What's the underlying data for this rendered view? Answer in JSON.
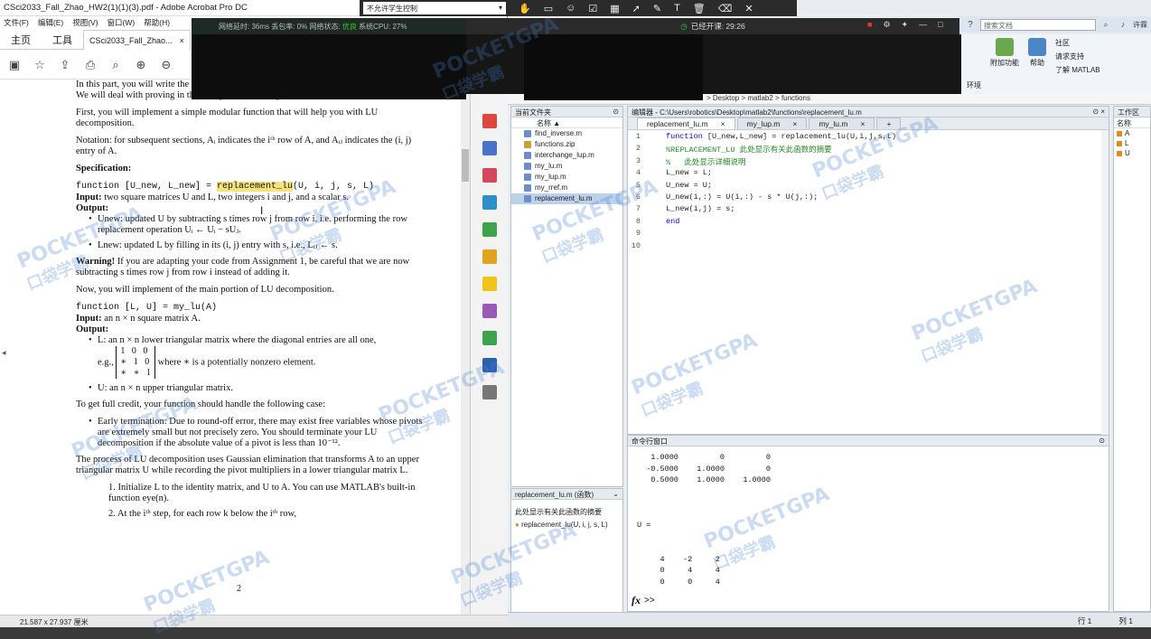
{
  "acrobat": {
    "title": "CSci2033_Fall_Zhao_HW2(1)(1)(3).pdf - Adobe Acrobat Pro DC",
    "menu": [
      "文件(F)",
      "编辑(E)",
      "视图(V)",
      "窗口(W)",
      "帮助(H)"
    ],
    "tabs": {
      "home": "主页",
      "tools": "工具",
      "doc": "CSci2033_Fall_Zhao...",
      "close": "×"
    },
    "status": "21.587 x 27.937 厘米",
    "page_number": "2"
  },
  "pdf": {
    "intro1": "In this part, you will write the function to perform LU decomposition with partial pivoting. We will deal with proving in the next part of the assignment.",
    "intro2": "First, you will implement a simple modular function that will help you with LU decomposition.",
    "notation": "Notation: for subsequent sections, Aᵢ indicates the iᵗʰ row of A, and Aᵢⱼ indicates the (i, j) entry of A.",
    "spec_heading": "Specification:",
    "sig1_pre": "function [U_new, L_new] = ",
    "sig1_hl": "replacement_lu",
    "sig1_post": "(U, i, j, s, L)",
    "input1_label": "Input:",
    "input1": " two square matrices U and L, two integers i and j, and a scalar s.",
    "output_label": "Output:",
    "out1": "Unew: updated U by subtracting s times row j from row i, i.e. performing the row replacement operation Uᵢ ← Uᵢ − sUⱼ.",
    "out2": "Lnew: updated L by filling in its (i, j) entry with s, i.e., Lᵢⱼ ← s.",
    "warning_label": "Warning!",
    "warning": " If you are adapting your code from Assignment 1, be careful that we are now subtracting s times row j from row i instead of adding it.",
    "now": "Now, you will implement of the main portion of LU decomposition.",
    "sig2": "function [L, U] = my_lu(A)",
    "input2_label": "Input:",
    "input2": " an n × n square matrix A.",
    "output2_label": "Output:",
    "outL": "L: an n × n lower triangular matrix where the diagonal entries are all one,",
    "eg": "e.g.,",
    "matrix_rows": [
      "1   0   0",
      "∗   1   0",
      "∗   ∗   1"
    ],
    "eg_after": " where ∗ is a potentially nonzero element.",
    "outU": "U: an n × n upper triangular matrix.",
    "credit": "To get full credit, your function should handle the following case:",
    "early": "Early termination: Due to round-off error, there may exist free variables whose pivots are extremely small but not precisely zero. You should terminate your LU decomposition if the absolute value of a pivot is less than 10⁻¹².",
    "process": "The process of LU decomposition uses Gaussian elimination that transforms A to an upper triangular matrix U while recording the pivot multipliers in a lower triangular matrix L.",
    "step1": "1. Initialize L to the identity matrix, and U to A. You can use MATLAB's built-in function eye(n).",
    "step2": "2. At the iᵗʰ step, for each row k below the iᵗʰ row,"
  },
  "overlay": {
    "netstat": "网络延时: 36ms  丢包率: 0%  网络状态: ",
    "netstat_ok": "优良",
    "cpu": "   系统CPU: 27%",
    "control": "不允许学生控制",
    "timer": "已经开课: 29:26"
  },
  "matlab": {
    "search_placeholder": "搜索文档",
    "user": "许霖",
    "ribbon": {
      "addons": "附加功能",
      "help": "帮助",
      "community": "社区",
      "support": "请求支持",
      "learn": "了解 MATLAB",
      "env": "环境"
    },
    "path": "> Desktop > matlab2 > functions",
    "current_folder": {
      "title": "当前文件夹",
      "col_name": "名称 ▲",
      "files": [
        "find_inverse.m",
        "functions.zip",
        "interchange_lup.m",
        "my_lu.m",
        "my_lup.m",
        "my_rref.m",
        "replacement_lu.m"
      ]
    },
    "details": {
      "title": "replacement_lu.m  (函数)",
      "desc": "此处显示有关此函数的摘要",
      "sig": "replacement_lu(U, i, j, s, L)"
    },
    "editor": {
      "title": "编辑器 - C:\\Users\\robotics\\Desktop\\matlab2\\functions\\replacement_lu.m",
      "tabs": [
        "replacement_lu.m",
        "my_lup.m",
        "my_lu.m"
      ],
      "add_tab": "+",
      "line_numbers": [
        "1",
        "2",
        "3",
        "4",
        "5",
        "6",
        "7",
        "8",
        "9",
        "10"
      ],
      "code": [
        {
          "kw": "function",
          "rest": " [U_new,L_new] = replacement_lu(U,i,j,s,L)"
        },
        {
          "cm": "%REPLACEMENT_LU 此处显示有关此函数的摘要"
        },
        {
          "cm": "%   此处显示详细说明"
        },
        {
          "rest": "L_new = L;"
        },
        {
          "rest": "U_new = U;"
        },
        {
          "rest": "U_new(i,:) = U(i,:) - s * U(j,:);"
        },
        {
          "rest": "L_new(i,j) = s;"
        },
        {
          "kw": "end"
        },
        {
          "rest": ""
        },
        {
          "rest": ""
        }
      ]
    },
    "command_window": {
      "title": "命令行窗口",
      "output": "   1.0000         0         0\n  -0.5000    1.0000         0\n   0.5000    1.0000    1.0000\n\n\n\nU =\n\n\n     4    -2     2\n     0     4     4\n     0     0     4",
      "prompt": ">>",
      "fx": "fx"
    },
    "workspace": {
      "title": "工作区",
      "col": "名称",
      "vars": [
        "A",
        "L",
        "U"
      ]
    },
    "status": {
      "row": "行  1",
      "col": "列  1"
    }
  },
  "watermark": {
    "brand": "POCKETGPA",
    "cn": "口袋学霸"
  }
}
